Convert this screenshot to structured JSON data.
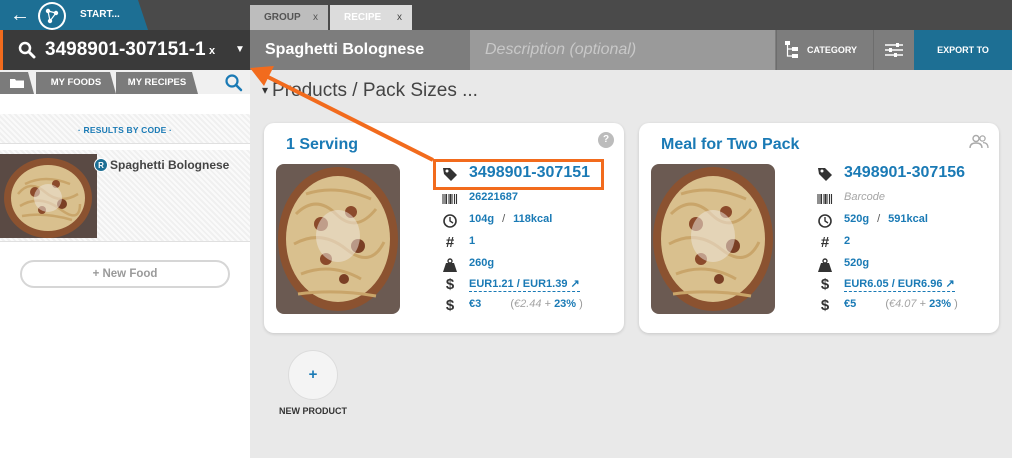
{
  "topbar": {
    "start_label": "START...",
    "tabs": [
      {
        "label": "GROUP",
        "close": "x"
      },
      {
        "label": "RECIPE",
        "close": "x"
      }
    ]
  },
  "search": {
    "value": "3498901-307151-1",
    "clear": "x"
  },
  "left_tabs": {
    "my_foods": "MY FOODS",
    "my_recipes": "MY RECIPES"
  },
  "left_panel": {
    "results_label": "· RESULTS BY CODE ·",
    "result": {
      "badge": "R",
      "name": "Spaghetti Bolognese"
    },
    "new_food_label": "+ New Food"
  },
  "recipe_header": {
    "name": "Spaghetti Bolognese",
    "description_placeholder": "Description (optional)",
    "category_label": "CATEGORY",
    "export_label": "EXPORT TO"
  },
  "section": {
    "title": "Products / Pack Sizes ...",
    "caret": "▾"
  },
  "cards": [
    {
      "title": "1 Serving",
      "help": "?",
      "code": "3498901-307151",
      "barcode": "26221687",
      "weight": "104g",
      "energy": "118kcal",
      "count": "1",
      "pack_weight": "260g",
      "price_range": "EUR1.21  / EUR1.39 ↗",
      "price": "€3",
      "cost": "€2.44",
      "margin": "23%"
    },
    {
      "title": "Meal for Two Pack",
      "code": "3498901-307156",
      "barcode": "Barcode",
      "weight": "520g",
      "energy": "591kcal",
      "count": "2",
      "pack_weight": "520g",
      "price_range": "EUR6.05  / EUR6.96 ↗",
      "price": "€5",
      "cost": "€4.07",
      "margin": "23%"
    }
  ],
  "new_product": {
    "plus": "+",
    "label": "NEW PRODUCT"
  },
  "colors": {
    "accent": "#1a7ab5",
    "brand": "#1d6f94",
    "highlight": "#f26b1d"
  }
}
